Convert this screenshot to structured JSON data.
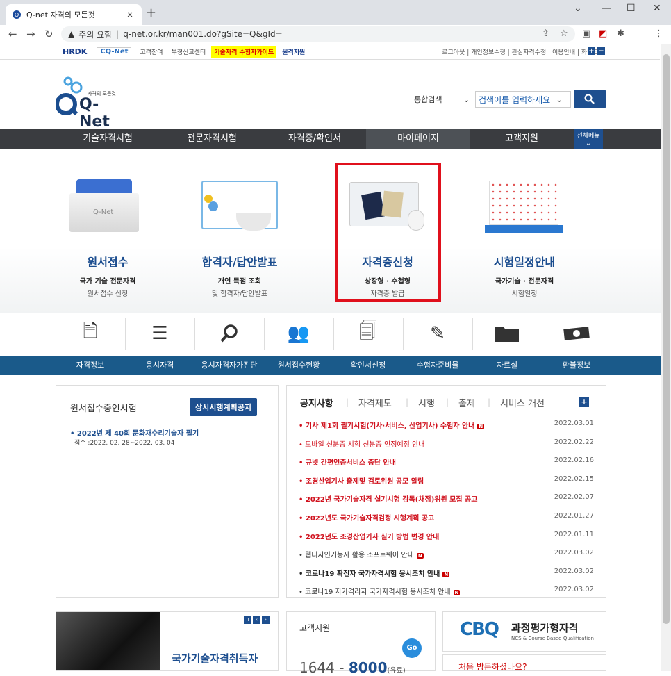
{
  "browser": {
    "tab_title": "Q-net 자격의 모든것",
    "tab_close": "×",
    "new_tab": "+",
    "security_label": "주의 요함",
    "url": "q-net.or.kr/man001.do?gSite=Q&gId=",
    "minimize": "—",
    "maximize": "☐",
    "close": "✕",
    "chevron": "⌄"
  },
  "util": {
    "hrdk": "HRDK",
    "cq": "CQ-Net",
    "links": [
      "고객참여",
      "부정신고센터"
    ],
    "highlight": "기술자격 수험자가이드",
    "remote": "원격지원",
    "right": "로그아웃 | 개인정보수정 | 관심자격수정 | 이용안내 | 화면크기"
  },
  "header": {
    "logo_tagline": "자격의 모든것",
    "logo_text": "Q-Net",
    "search_select": "통합검색",
    "search_placeholder": "검색어를 입력하세요"
  },
  "gnb": [
    "기술자격시험",
    "전문자격시험",
    "자격증/확인서",
    "마이페이지",
    "고객지원"
  ],
  "gnb_all": "전체메뉴",
  "hero": [
    {
      "title": "원서접수",
      "sub1": "국가 기술 전문자격",
      "sub2": "원서접수 신청"
    },
    {
      "title": "합격자/답안발표",
      "sub1": "개인 득점 조회",
      "sub2": "및 합격자/답안발표"
    },
    {
      "title": "자격증신청",
      "sub1": "상장형 · 수첩형",
      "sub2": "자격증 발급"
    },
    {
      "title": "시험일정안내",
      "sub1": "국가기술 · 전문자격",
      "sub2": "시험일정"
    }
  ],
  "quick": [
    "자격정보",
    "응시자격",
    "응시자격자가진단",
    "원서접수현황",
    "확인서신청",
    "수험자준비물",
    "자료실",
    "환불정보"
  ],
  "exam": {
    "title": "원서접수중인시험",
    "button": "상시시행계획공지",
    "item": "• 2022년 제 40회 문화재수리기술자 필기",
    "period": "접수 :2022. 02. 28~2022. 03. 04"
  },
  "notice_tabs": [
    "공지사항",
    "자격제도",
    "시행",
    "출제",
    "서비스 개선"
  ],
  "notices": [
    {
      "t": "기사 제1회 필기시험(기사·서비스, 산업기사) 수험자 안내",
      "d": "2022.03.01",
      "color": "#d0101c",
      "bold": true,
      "new": true
    },
    {
      "t": "모바일 신분증 시험 신분증 인정예정 안내",
      "d": "2022.02.22",
      "color": "#d0101c",
      "bold": false,
      "new": false
    },
    {
      "t": "큐넷 간편인증서비스 중단 안내",
      "d": "2022.02.16",
      "color": "#d0101c",
      "bold": true,
      "new": false
    },
    {
      "t": "조경산업기사 출제및 검토위원 공모 알림",
      "d": "2022.02.15",
      "color": "#d0101c",
      "bold": true,
      "new": false
    },
    {
      "t": "2022년 국가기술자격 실기시험 감독(채점)위원 모집 공고",
      "d": "2022.02.07",
      "color": "#d0101c",
      "bold": true,
      "new": false
    },
    {
      "t": "2022년도 국가기술자격검정 시행계획 공고",
      "d": "2022.01.27",
      "color": "#d0101c",
      "bold": true,
      "new": false
    },
    {
      "t": "2022년도 조경산업기사 실기 방법 변경 안내",
      "d": "2022.01.11",
      "color": "#d0101c",
      "bold": true,
      "new": false
    },
    {
      "t": "웹디자인기능사 활용 소프트웨어 안내",
      "d": "2022.03.02",
      "color": "#333333",
      "bold": false,
      "new": true
    },
    {
      "t": "코로나19 확진자 국가자격시험 응시조치 안내",
      "d": "2022.03.02",
      "color": "#222222",
      "bold": true,
      "new": true
    },
    {
      "t": "코로나19 자가격리자 국가자격시험 응시조치 안내",
      "d": "2022.03.02",
      "color": "#333333",
      "bold": false,
      "new": true
    }
  ],
  "new_badge": "N",
  "bottom": {
    "banner": "국가기술자격취득자",
    "cs_title": "고객지원",
    "go": "Go",
    "phone_a": "1644",
    "phone_sep": " - ",
    "phone_b": "8000",
    "phone_note": "(유료)",
    "cbq_logo": "CBQ",
    "cbq_name": "과정평가형자격",
    "cbq_sub": "NCS & Course Based Qualification",
    "cbq2": "처음 방문하셨나요?"
  }
}
